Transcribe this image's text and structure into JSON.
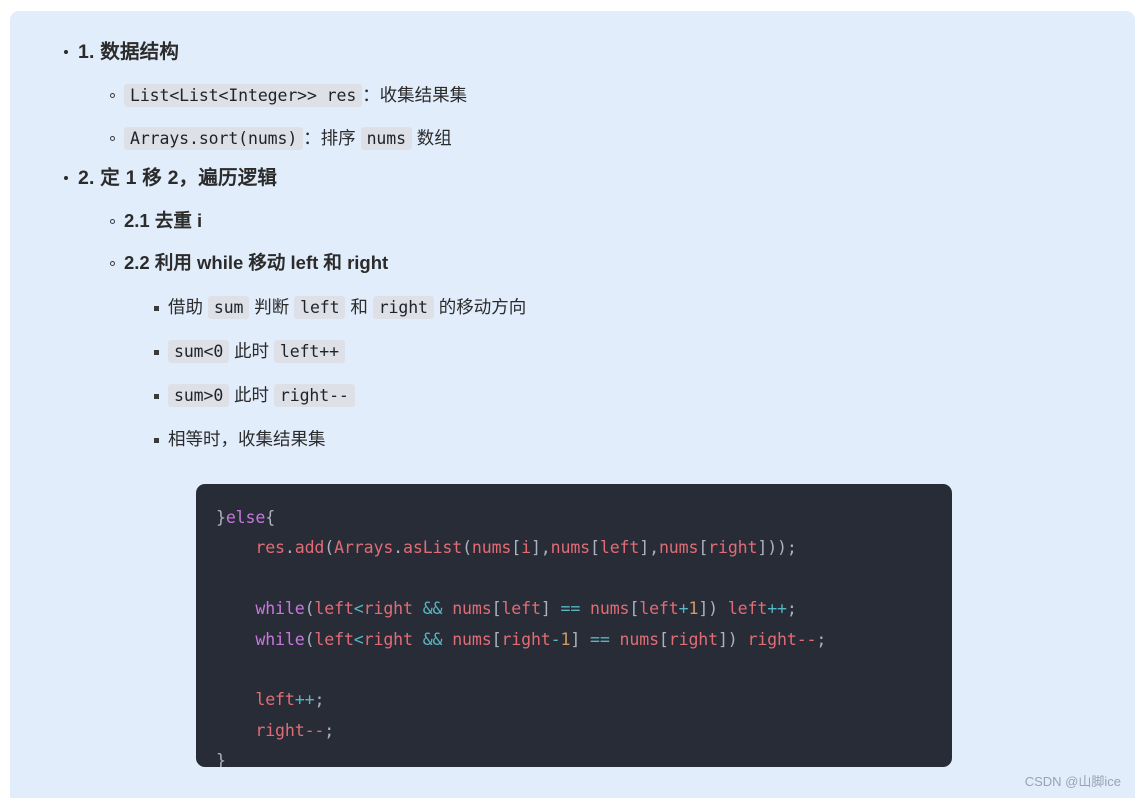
{
  "theme": {
    "page_bg": "#e2edfb",
    "outer_bg": "#ffffff",
    "text_color": "#2b2b2b",
    "chip_bg": "#dde1e7",
    "code_bg": "#282c37",
    "code_default": "#abb2bf",
    "code_keyword": "#c678dd",
    "code_identifier": "#e06c75",
    "code_operator": "#56b6c2",
    "code_number": "#d19a66",
    "watermark_color": "#9aa3ae"
  },
  "outline": {
    "sections": [
      {
        "id": "s1",
        "heading": "1. 数据结构",
        "children": [
          {
            "id": "s1c1",
            "parts": [
              {
                "kind": "code",
                "text": "List<List<Integer>> res"
              },
              {
                "kind": "text",
                "text": "：收集结果集"
              }
            ]
          },
          {
            "id": "s1c2",
            "parts": [
              {
                "kind": "code",
                "text": "Arrays.sort(nums)"
              },
              {
                "kind": "text",
                "text": "：排序 "
              },
              {
                "kind": "code",
                "text": "nums"
              },
              {
                "kind": "text",
                "text": " 数组"
              }
            ]
          }
        ]
      },
      {
        "id": "s2",
        "heading": "2. 定 1 移 2，遍历逻辑",
        "children": [
          {
            "id": "s2c1",
            "bold": true,
            "parts": [
              {
                "kind": "text",
                "text": "2.1 去重 i"
              }
            ]
          },
          {
            "id": "s2c2",
            "bold": true,
            "parts": [
              {
                "kind": "text",
                "text": "2.2 利用 while 移动 left 和 right"
              }
            ],
            "children": [
              {
                "id": "s2c2a",
                "parts": [
                  {
                    "kind": "text",
                    "text": "借助 "
                  },
                  {
                    "kind": "code",
                    "text": "sum"
                  },
                  {
                    "kind": "text",
                    "text": " 判断 "
                  },
                  {
                    "kind": "code",
                    "text": "left"
                  },
                  {
                    "kind": "text",
                    "text": " 和 "
                  },
                  {
                    "kind": "code",
                    "text": "right"
                  },
                  {
                    "kind": "text",
                    "text": " 的移动方向"
                  }
                ]
              },
              {
                "id": "s2c2b",
                "parts": [
                  {
                    "kind": "code",
                    "text": "sum<0"
                  },
                  {
                    "kind": "text",
                    "text": " 此时 "
                  },
                  {
                    "kind": "code",
                    "text": "left++"
                  }
                ]
              },
              {
                "id": "s2c2c",
                "parts": [
                  {
                    "kind": "code",
                    "text": "sum>0"
                  },
                  {
                    "kind": "text",
                    "text": " 此时 "
                  },
                  {
                    "kind": "code",
                    "text": "right--"
                  }
                ]
              },
              {
                "id": "s2c2d",
                "parts": [
                  {
                    "kind": "text",
                    "text": "相等时，收集结果集"
                  }
                ]
              }
            ]
          }
        ]
      }
    ]
  },
  "code_block": {
    "language": "java",
    "lines": [
      [
        {
          "t": "}",
          "c": "pn"
        },
        {
          "t": "else",
          "c": "kw"
        },
        {
          "t": "{",
          "c": "pn"
        }
      ],
      [
        {
          "t": "    ",
          "c": "pn"
        },
        {
          "t": "res",
          "c": "id"
        },
        {
          "t": ".",
          "c": "pn"
        },
        {
          "t": "add",
          "c": "id"
        },
        {
          "t": "(",
          "c": "pn"
        },
        {
          "t": "Arrays",
          "c": "id"
        },
        {
          "t": ".",
          "c": "pn"
        },
        {
          "t": "asList",
          "c": "id"
        },
        {
          "t": "(",
          "c": "pn"
        },
        {
          "t": "nums",
          "c": "id"
        },
        {
          "t": "[",
          "c": "pn"
        },
        {
          "t": "i",
          "c": "id"
        },
        {
          "t": "],",
          "c": "pn"
        },
        {
          "t": "nums",
          "c": "id"
        },
        {
          "t": "[",
          "c": "pn"
        },
        {
          "t": "left",
          "c": "id"
        },
        {
          "t": "],",
          "c": "pn"
        },
        {
          "t": "nums",
          "c": "id"
        },
        {
          "t": "[",
          "c": "pn"
        },
        {
          "t": "right",
          "c": "id"
        },
        {
          "t": "]));",
          "c": "pn"
        }
      ],
      [
        {
          "t": "",
          "c": "pn"
        }
      ],
      [
        {
          "t": "    ",
          "c": "pn"
        },
        {
          "t": "while",
          "c": "kw"
        },
        {
          "t": "(",
          "c": "pn"
        },
        {
          "t": "left",
          "c": "id"
        },
        {
          "t": "<",
          "c": "op"
        },
        {
          "t": "right",
          "c": "id"
        },
        {
          "t": " ",
          "c": "pn"
        },
        {
          "t": "&&",
          "c": "op"
        },
        {
          "t": " ",
          "c": "pn"
        },
        {
          "t": "nums",
          "c": "id"
        },
        {
          "t": "[",
          "c": "pn"
        },
        {
          "t": "left",
          "c": "id"
        },
        {
          "t": "] ",
          "c": "pn"
        },
        {
          "t": "==",
          "c": "op"
        },
        {
          "t": " ",
          "c": "pn"
        },
        {
          "t": "nums",
          "c": "id"
        },
        {
          "t": "[",
          "c": "pn"
        },
        {
          "t": "left",
          "c": "id"
        },
        {
          "t": "+",
          "c": "op"
        },
        {
          "t": "1",
          "c": "num"
        },
        {
          "t": "]) ",
          "c": "pn"
        },
        {
          "t": "left",
          "c": "id"
        },
        {
          "t": "++",
          "c": "op"
        },
        {
          "t": ";",
          "c": "pn"
        }
      ],
      [
        {
          "t": "    ",
          "c": "pn"
        },
        {
          "t": "while",
          "c": "kw"
        },
        {
          "t": "(",
          "c": "pn"
        },
        {
          "t": "left",
          "c": "id"
        },
        {
          "t": "<",
          "c": "op"
        },
        {
          "t": "right",
          "c": "id"
        },
        {
          "t": " ",
          "c": "pn"
        },
        {
          "t": "&&",
          "c": "op"
        },
        {
          "t": " ",
          "c": "pn"
        },
        {
          "t": "nums",
          "c": "id"
        },
        {
          "t": "[",
          "c": "pn"
        },
        {
          "t": "right",
          "c": "id"
        },
        {
          "t": "-",
          "c": "op"
        },
        {
          "t": "1",
          "c": "num"
        },
        {
          "t": "] ",
          "c": "pn"
        },
        {
          "t": "==",
          "c": "op"
        },
        {
          "t": " ",
          "c": "pn"
        },
        {
          "t": "nums",
          "c": "id"
        },
        {
          "t": "[",
          "c": "pn"
        },
        {
          "t": "right",
          "c": "id"
        },
        {
          "t": "]) ",
          "c": "pn"
        },
        {
          "t": "right",
          "c": "id"
        },
        {
          "t": "--",
          "c": "id"
        },
        {
          "t": ";",
          "c": "pn"
        }
      ],
      [
        {
          "t": "",
          "c": "pn"
        }
      ],
      [
        {
          "t": "    ",
          "c": "pn"
        },
        {
          "t": "left",
          "c": "id"
        },
        {
          "t": "++",
          "c": "op"
        },
        {
          "t": ";",
          "c": "pn"
        }
      ],
      [
        {
          "t": "    ",
          "c": "pn"
        },
        {
          "t": "right",
          "c": "id"
        },
        {
          "t": "--",
          "c": "id"
        },
        {
          "t": ";",
          "c": "pn"
        }
      ],
      [
        {
          "t": "}",
          "c": "pn"
        }
      ]
    ]
  },
  "watermark": {
    "text": "CSDN @山脚ice"
  }
}
